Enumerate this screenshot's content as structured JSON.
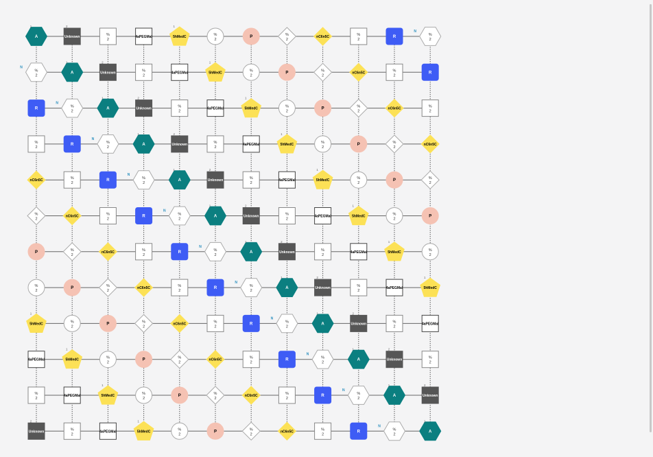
{
  "diagram": {
    "node_types": {
      "A": {
        "label": "A",
        "shape": "hexagon",
        "fill": "#0b7f80",
        "stroke": "#0b7f80",
        "text": "#ffffff"
      },
      "Unknown": {
        "label": "Unknown",
        "shape": "square",
        "fill": "#565656",
        "stroke": "#565656",
        "text": "#ffffff"
      },
      "f": {
        "top": "%",
        "bottom": "2",
        "shape": "square",
        "fill": "#ffffff",
        "stroke": "#888888",
        "text": "#333333"
      },
      "4aPEGMal": {
        "label": "4aPEGMal",
        "shape": "square",
        "fill": "#ffffff",
        "stroke": "#444444",
        "text": "#000000"
      },
      "5hMedC": {
        "label": "5hMedC",
        "shape": "pentagon",
        "fill": "#fce156",
        "stroke": "#fce156",
        "text": "#000000"
      },
      "c": {
        "top": "%",
        "bottom": "2",
        "shape": "circle",
        "fill": "#ffffff",
        "stroke": "#aaaaaa",
        "text": "#333333"
      },
      "P": {
        "label": "P",
        "shape": "circle",
        "fill": "#f5c2b3",
        "stroke": "#f5c2b3",
        "text": "#000000"
      },
      "d": {
        "top": "%",
        "bottom": "2",
        "shape": "diamond",
        "fill": "#ffffff",
        "stroke": "#aaaaaa",
        "text": "#333333"
      },
      "nC6n5C": {
        "label": "nC6n5C",
        "shape": "diamond",
        "fill": "#fce156",
        "stroke": "#fce156",
        "text": "#000000"
      },
      "R": {
        "label": "R",
        "shape": "roundsq",
        "fill": "#3e5cf5",
        "stroke": "#3e5cf5",
        "text": "#ffffff"
      },
      "h": {
        "top": "%",
        "bottom": "2",
        "shape": "hexagon",
        "fill": "#ffffff",
        "stroke": "#aaaaaa",
        "text": "#333333"
      }
    },
    "sequence": [
      "A",
      "Unknown",
      "f",
      "4aPEGMal",
      "5hMedC",
      "c",
      "P",
      "d",
      "nC6n5C",
      "f",
      "R",
      "h"
    ],
    "rows": 12,
    "cols": 12,
    "mark_labels": {
      "h": "N",
      "A": "1",
      "Unknown": "2",
      "5hMedC": "1"
    },
    "colors": {
      "edge": "#666666",
      "link": "#555555",
      "mark_n": "#2a8fbf",
      "mark_num": "#666666"
    }
  }
}
